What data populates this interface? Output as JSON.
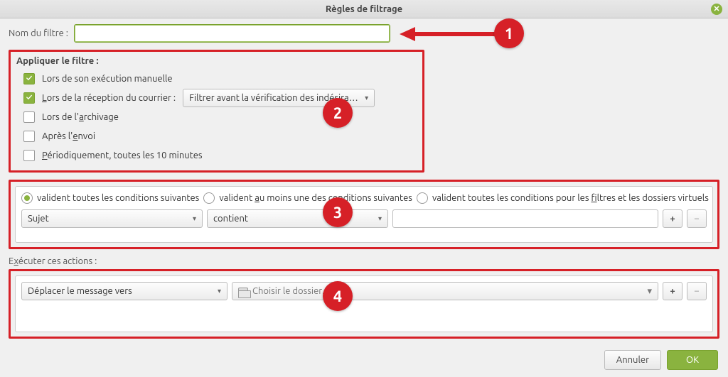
{
  "window": {
    "title": "Règles de filtrage"
  },
  "filter_name": {
    "label": "Nom du filtre :",
    "value": ""
  },
  "apply": {
    "title": "Appliquer le filtre :",
    "manual": {
      "label_html": "Lors de son exécution manuelle",
      "checked": true
    },
    "on_receive": {
      "label_html": "<u>L</u>ors de la réception du courrier :",
      "checked": true,
      "dropdown": "Filtrer avant la vérification des indésira…"
    },
    "archiving": {
      "label_html": "Lors de l'<u>a</u>rchivage",
      "checked": false
    },
    "after_send": {
      "label_html": "Après l'<u>e</u>nvoi",
      "checked": false
    },
    "periodic": {
      "label_html": "<u>P</u>ériodiquement, toutes les 10 minutes",
      "checked": false
    }
  },
  "conditions": {
    "radio_all": "valident toutes les conditions suivantes",
    "radio_any_html": "valident <u>a</u>u moins une des conditions suivantes",
    "radio_virt_html": "valident toutes les conditions pour les <u>f</u>iltres et les dossiers virtuels",
    "selected": "all",
    "row": {
      "field": "Sujet",
      "op": "contient",
      "value": ""
    }
  },
  "actions": {
    "title_html": "E<u>x</u>écuter ces actions :",
    "row": {
      "action": "Déplacer le message vers",
      "target_placeholder": "Choisir le dossier…"
    }
  },
  "footer": {
    "cancel": "Annuler",
    "ok": "OK"
  },
  "callouts": {
    "c1": "1",
    "c2": "2",
    "c3": "3",
    "c4": "4"
  }
}
